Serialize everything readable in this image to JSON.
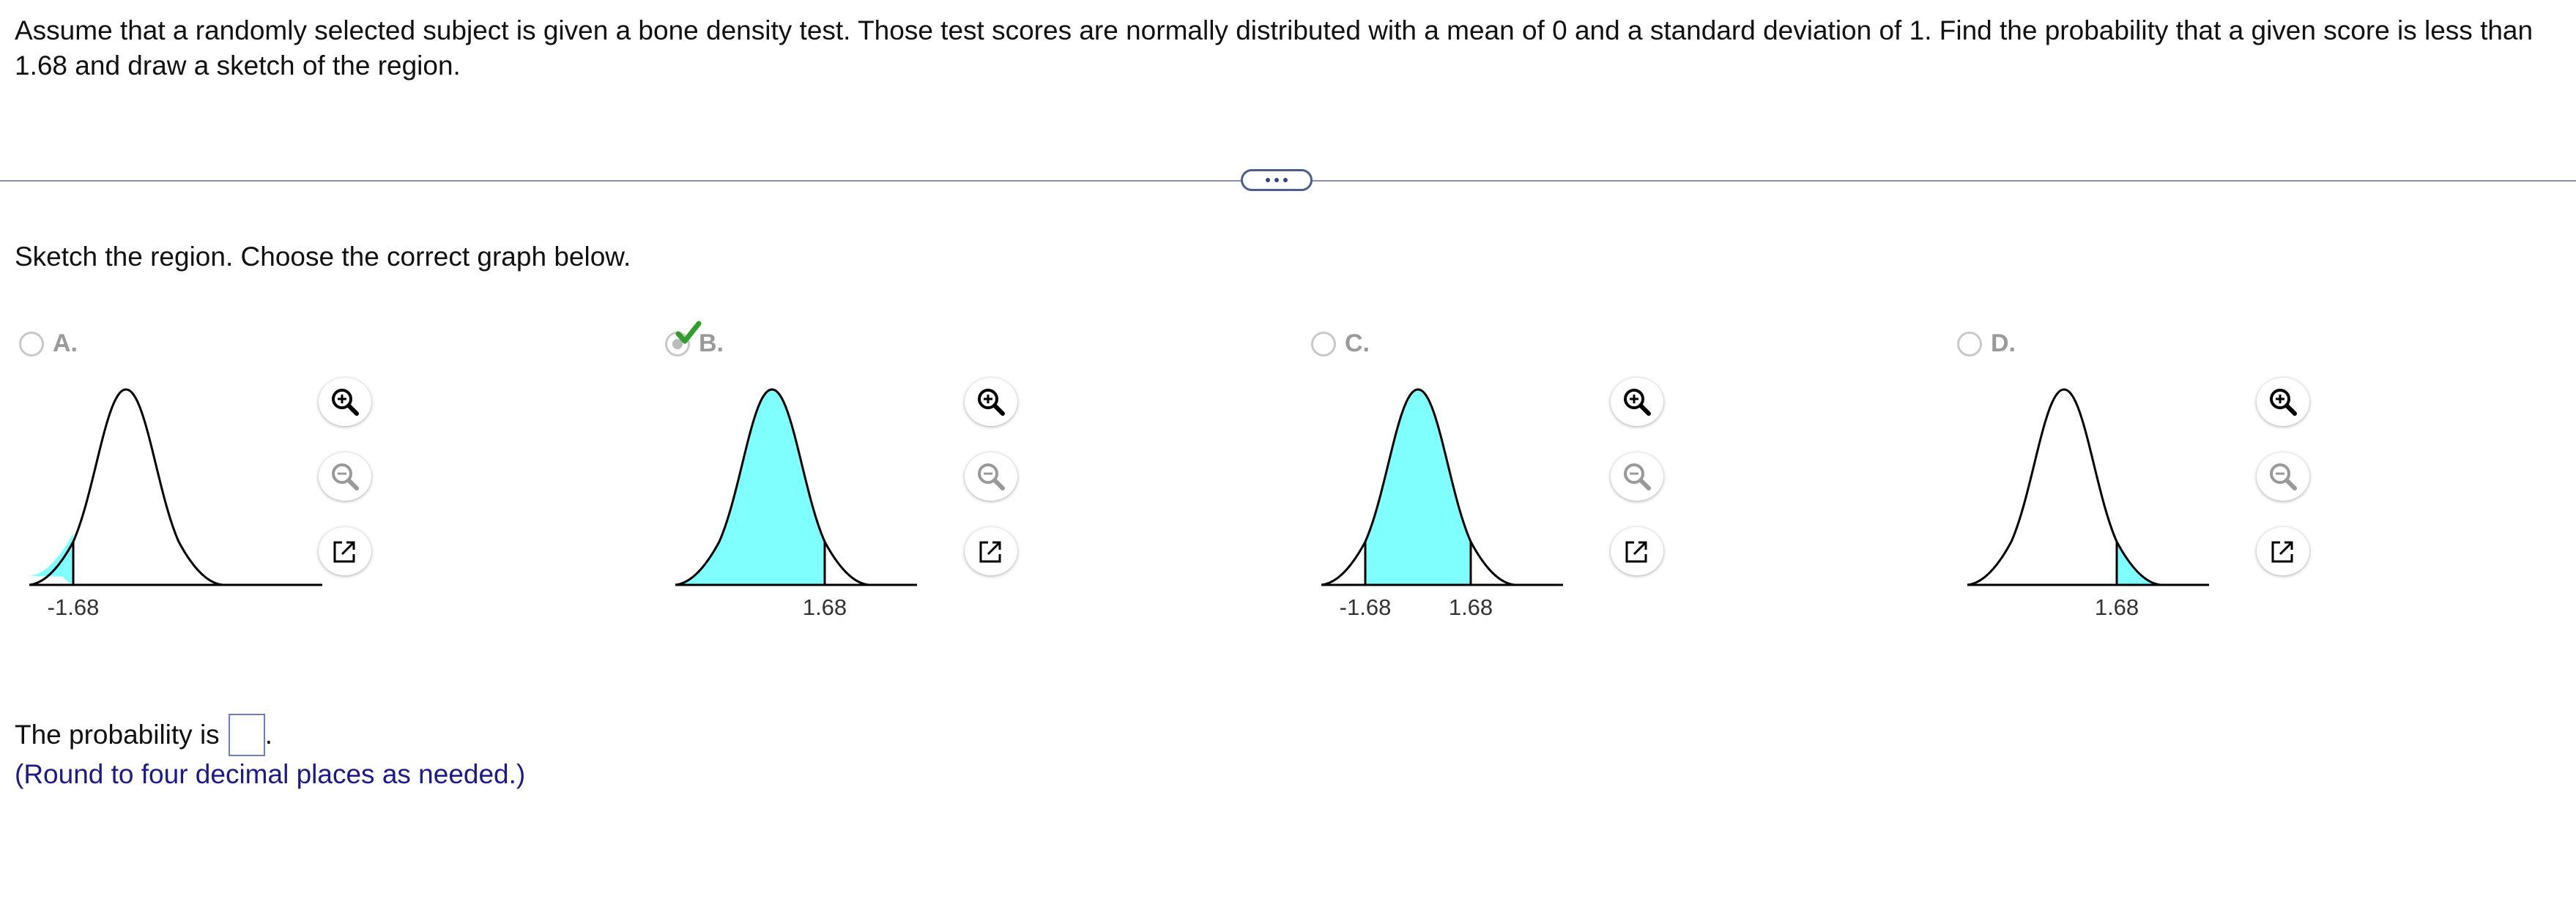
{
  "question": "Assume that a randomly selected subject is given a bone density test. Those test scores are normally distributed with a mean of 0 and a standard deviation of 1. Find the probability that a given score is less than 1.68 and draw a sketch of the region.",
  "prompt": "Sketch the region. Choose the correct graph below.",
  "options": [
    {
      "letter": "A.",
      "selected": false,
      "shading": "left tail below -1.68",
      "tick_labels": [
        "-1.68"
      ]
    },
    {
      "letter": "B.",
      "selected": true,
      "shading": "left of 1.68",
      "tick_labels": [
        "1.68"
      ]
    },
    {
      "letter": "C.",
      "selected": false,
      "shading": "between -1.68 and 1.68",
      "tick_labels": [
        "-1.68",
        "1.68"
      ]
    },
    {
      "letter": "D.",
      "selected": false,
      "shading": "right tail above 1.68",
      "tick_labels": [
        "1.68"
      ]
    }
  ],
  "tools": {
    "zoom_in": "zoom-in-icon",
    "zoom_out": "zoom-out-icon",
    "popout": "popout-icon"
  },
  "answer": {
    "prefix": "The probability is",
    "value": "",
    "suffix": "."
  },
  "hint": "(Round to four decimal places as needed.)",
  "colors": {
    "shade": "#80ffff",
    "check": "#2e9e2e",
    "hint": "#1a1a8c",
    "divider": "#8c8cb4"
  }
}
